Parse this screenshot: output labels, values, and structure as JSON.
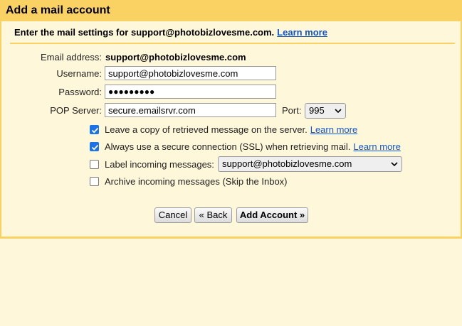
{
  "header": {
    "title": "Add a mail account"
  },
  "intro": {
    "text": "Enter the mail settings for support@photobizlovesme.com.",
    "learn_more": "Learn more"
  },
  "form": {
    "email_label": "Email address:",
    "email_value": "support@photobizlovesme.com",
    "username_label": "Username:",
    "username_value": "support@photobizlovesme.com",
    "password_label": "Password:",
    "password_value": "●●●●●●●●●",
    "pop_label": "POP Server:",
    "pop_value": "secure.emailsrvr.com",
    "port_label": "Port:",
    "port_value": "995"
  },
  "options": {
    "leave_copy": {
      "label": "Leave a copy of retrieved message on the server.",
      "learn_more": "Learn more",
      "checked": true
    },
    "secure": {
      "label": "Always use a secure connection (SSL) when retrieving mail.",
      "learn_more": "Learn more",
      "checked": true
    },
    "label_incoming": {
      "label": "Label incoming messages:",
      "select_value": "support@photobizlovesme.com",
      "checked": false
    },
    "archive": {
      "label": "Archive incoming messages (Skip the Inbox)",
      "checked": false
    }
  },
  "buttons": {
    "cancel": "Cancel",
    "back": "« Back",
    "add": "Add Account »"
  },
  "colors": {
    "header_bg": "#fad163",
    "panel_bg": "#fff7d9",
    "link": "#1155cc",
    "checkbox": "#1a73e8"
  },
  "icons": {
    "checkbox_checked": "checkmark-icon",
    "dropdown": "chevron-down-icon"
  }
}
